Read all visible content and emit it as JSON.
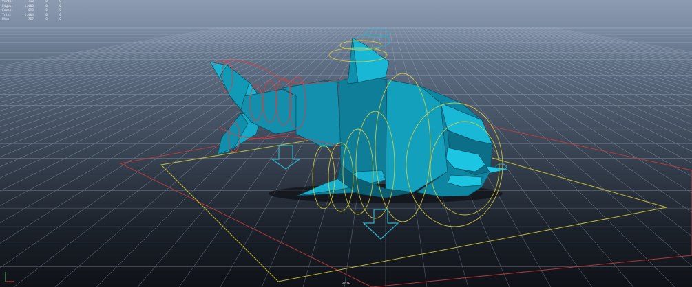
{
  "hud": {
    "rows": [
      {
        "label": "Verts:",
        "v1": "710",
        "v2": "0",
        "v3": "0"
      },
      {
        "label": "Edges:",
        "v1": "1,406",
        "v2": "0",
        "v3": "0"
      },
      {
        "label": "Faces:",
        "v1": "698",
        "v2": "0",
        "v3": "0"
      },
      {
        "label": "Tris:",
        "v1": "1,404",
        "v2": "0",
        "v3": "0"
      },
      {
        "label": "UVs:",
        "v1": "767",
        "v2": "0",
        "v3": "0"
      }
    ]
  },
  "viewport": {
    "camera_label": "persp"
  },
  "colors": {
    "background_top": "#8c9bb0",
    "background_bottom": "#0f1217",
    "grid": "#aebbd0",
    "mesh": "#15a6c4",
    "mesh_dark": "#0b6f86",
    "spine_controls": "#e03a3a",
    "controls_yellow": "#d8cf3c",
    "arrow_cyan": "#2fb0c8"
  },
  "objects": [
    {
      "name": "shark-mesh",
      "type": "polygon mesh"
    },
    {
      "name": "rig-controls",
      "type": "nurbs curves"
    }
  ]
}
